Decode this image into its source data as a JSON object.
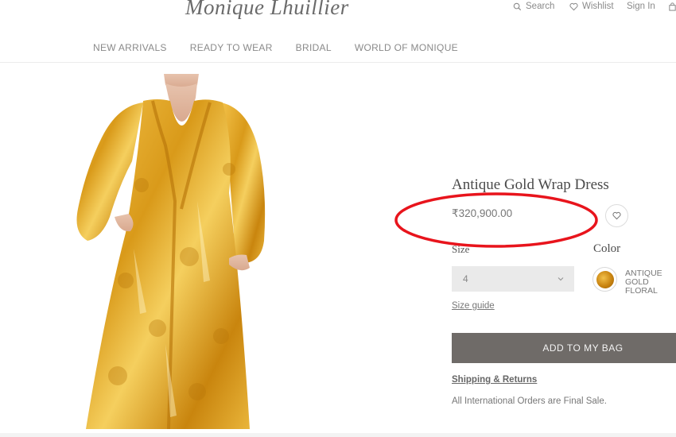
{
  "header": {
    "logo": "Monique Lhuillier",
    "search_label": "Search",
    "wishlist_label": "Wishlist",
    "signin_label": "Sign In"
  },
  "nav": {
    "items": [
      "NEW ARRIVALS",
      "READY TO WEAR",
      "BRIDAL",
      "WORLD OF MONIQUE"
    ]
  },
  "product": {
    "title": "Antique Gold Wrap Dress",
    "price": "₹320,900.00",
    "size_label": "Size",
    "size_value": "4",
    "color_label": "Color",
    "color_name": "ANTIQUE GOLD FLORAL",
    "size_guide_label": "Size guide",
    "add_to_bag_label": "ADD TO MY BAG",
    "shipping_label": "Shipping & Returns",
    "sale_note": "All International Orders are Final Sale."
  },
  "colors": {
    "annotation": "#e8141c",
    "button_bg": "#6f6b68",
    "dress_gold": "#e0a21f"
  }
}
